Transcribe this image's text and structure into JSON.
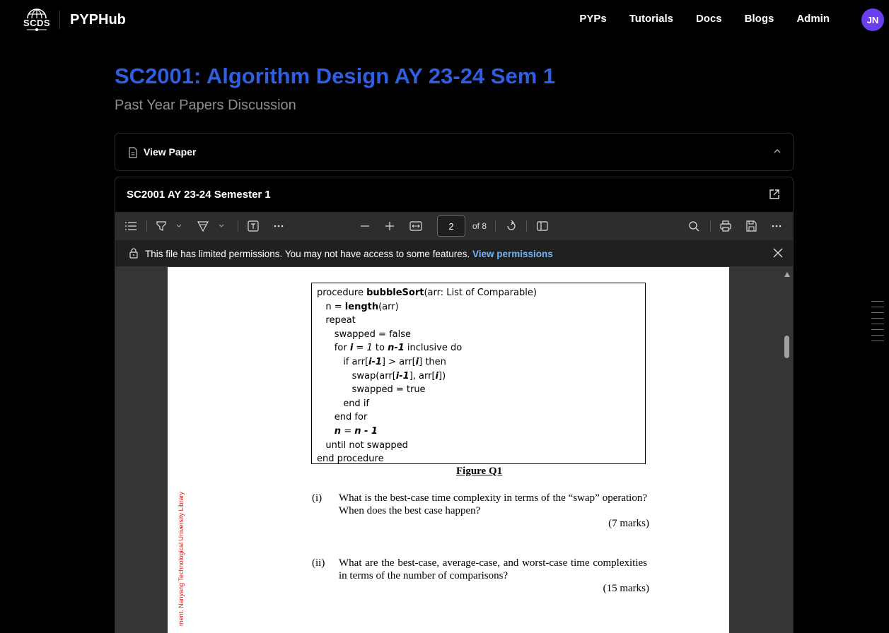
{
  "nav": {
    "logo_text": "SCDS",
    "brand": "PYPHub",
    "links": [
      "PYPs",
      "Tutorials",
      "Docs",
      "Blogs",
      "Admin"
    ],
    "avatar": "JN"
  },
  "page": {
    "title": "SC2001: Algorithm Design AY 23-24 Sem 1",
    "subtitle": "Past Year Papers Discussion"
  },
  "view_paper": {
    "label": "View Paper"
  },
  "pdf": {
    "header_title": "SC2001 AY 23-24 Semester 1",
    "toolbar": {
      "page_number": "2",
      "page_of": "of 8"
    },
    "permission": {
      "message": "This file has limited permissions. You may not have access to some features.",
      "link": "View permissions"
    },
    "document": {
      "code_lines": [
        "procedure **bubbleSort**(arr: List of Comparable)",
        "   n = **length**(arr)",
        "   repeat",
        "      swapped = false",
        "      for ***i*** = *1* to ***n-1*** inclusive do",
        "         if arr[***i-1***] > arr[***i***] then",
        "            swap(arr[***i-1***], arr[***i***])",
        "            swapped = true",
        "         end if",
        "      end for",
        "      ***n*** = ***n - 1***",
        "   until not swapped",
        "end procedure"
      ],
      "figure_caption": "Figure Q1",
      "questions": [
        {
          "num": "(i)",
          "text": "What is the best-case time complexity in terms of the “swap” operation? When does the best case happen?",
          "marks": "(7 marks)"
        },
        {
          "num": "(ii)",
          "text": "What are the best-case, average-case, and worst-case time complexities in terms of the number of comparisons?",
          "marks": "(15 marks)"
        }
      ],
      "side_text": "ment. Nanyang Technological University Library"
    }
  }
}
